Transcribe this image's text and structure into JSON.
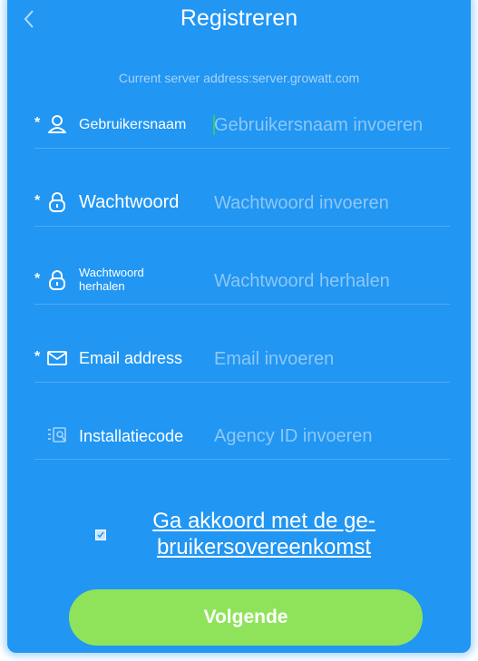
{
  "header": {
    "title": "Registreren"
  },
  "server": {
    "text": "Current server address:server.growatt.com"
  },
  "form": {
    "username": {
      "required": "*",
      "label": "Gebruikersnaam",
      "placeholder": "Gebruikersnaam invoeren",
      "icon": "user-icon"
    },
    "password": {
      "required": "*",
      "label": "Wachtwoord",
      "placeholder": "Wachtwoord invoeren",
      "icon": "lock-icon"
    },
    "password_repeat": {
      "required": "*",
      "label_line1": "Wachtwoord",
      "label_line2": "herhalen",
      "placeholder": "Wachtwoord herhalen",
      "icon": "lock-icon"
    },
    "email": {
      "required": "*",
      "label": "Email address",
      "placeholder": "Email invoeren",
      "icon": "envelope-icon"
    },
    "install_code": {
      "label": "Installatiecode",
      "placeholder": "Agency ID invoeren",
      "icon": "agency-icon"
    }
  },
  "agreement": {
    "checked": true,
    "line1": "Ga akkoord met de ge-",
    "line2": "bruikersovereenkomst"
  },
  "next_button": {
    "label": "Volgende"
  },
  "colors": {
    "background": "#2196f3",
    "button": "#8fe35b",
    "placeholder": "#8ec7f7",
    "server_text": "#a9d3fb"
  }
}
